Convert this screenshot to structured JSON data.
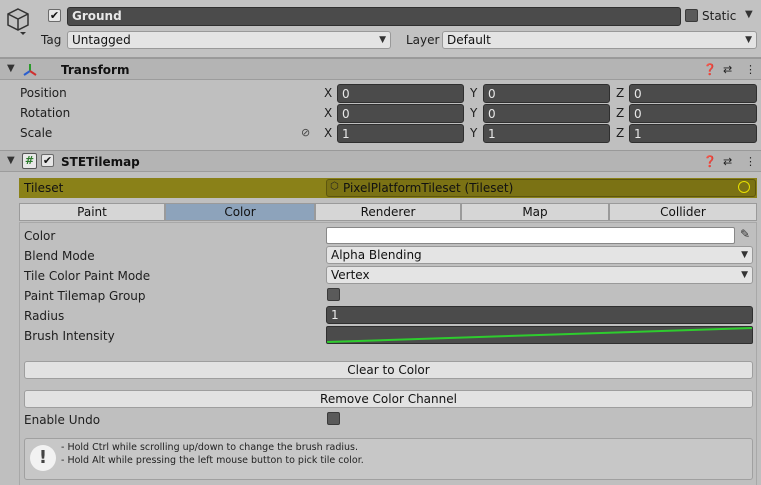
{
  "gameobject": {
    "active_checked": "✔",
    "name": "Ground",
    "static_label": "Static",
    "tag_label": "Tag",
    "tag_value": "Untagged",
    "layer_label": "Layer",
    "layer_value": "Default"
  },
  "transform": {
    "title": "Transform",
    "position_label": "Position",
    "rotation_label": "Rotation",
    "scale_label": "Scale",
    "axis_x": "X",
    "axis_y": "Y",
    "axis_z": "Z",
    "position": {
      "x": "0",
      "y": "0",
      "z": "0"
    },
    "rotation": {
      "x": "0",
      "y": "0",
      "z": "0"
    },
    "scale": {
      "x": "1",
      "y": "1",
      "z": "1"
    }
  },
  "stetilemap": {
    "title": "STETilemap",
    "enabled_checked": "✔",
    "tileset_label": "Tileset",
    "tileset_value": "PixelPlatformTileset (Tileset)",
    "tabs": [
      {
        "label": "Paint",
        "active": false
      },
      {
        "label": "Color",
        "active": true
      },
      {
        "label": "Renderer",
        "active": false
      },
      {
        "label": "Map",
        "active": false
      },
      {
        "label": "Collider",
        "active": false
      }
    ],
    "color_label": "Color",
    "color_value": "#ffffff",
    "blend_mode_label": "Blend Mode",
    "blend_mode_value": "Alpha Blending",
    "tile_color_paint_mode_label": "Tile Color Paint Mode",
    "tile_color_paint_mode_value": "Vertex",
    "paint_tilemap_group_label": "Paint Tilemap Group",
    "radius_label": "Radius",
    "radius_value": "1",
    "brush_intensity_label": "Brush Intensity",
    "curve_color": "#2ecc2e",
    "clear_to_color_label": "Clear to Color",
    "remove_color_channel_label": "Remove Color Channel",
    "enable_undo_label": "Enable Undo",
    "help_line_1": "- Hold Ctrl while scrolling up/down to change the brush radius.",
    "help_line_2": "- Hold Alt while pressing the left mouse button to pick tile color."
  },
  "icons": {
    "object": "cube-icon",
    "transform": "transform-axes-icon",
    "script": "script-hash-icon",
    "help": "help-icon",
    "presets": "presets-icon",
    "menu": "kebab-menu-icon",
    "pick": "eyedropper-icon",
    "info": "info-icon"
  },
  "colors": {
    "background": "#bfbfbf",
    "active_tab": "#8da3bb",
    "tileset_highlight": "#8a8118",
    "field_dark": "#4b4b4b"
  }
}
